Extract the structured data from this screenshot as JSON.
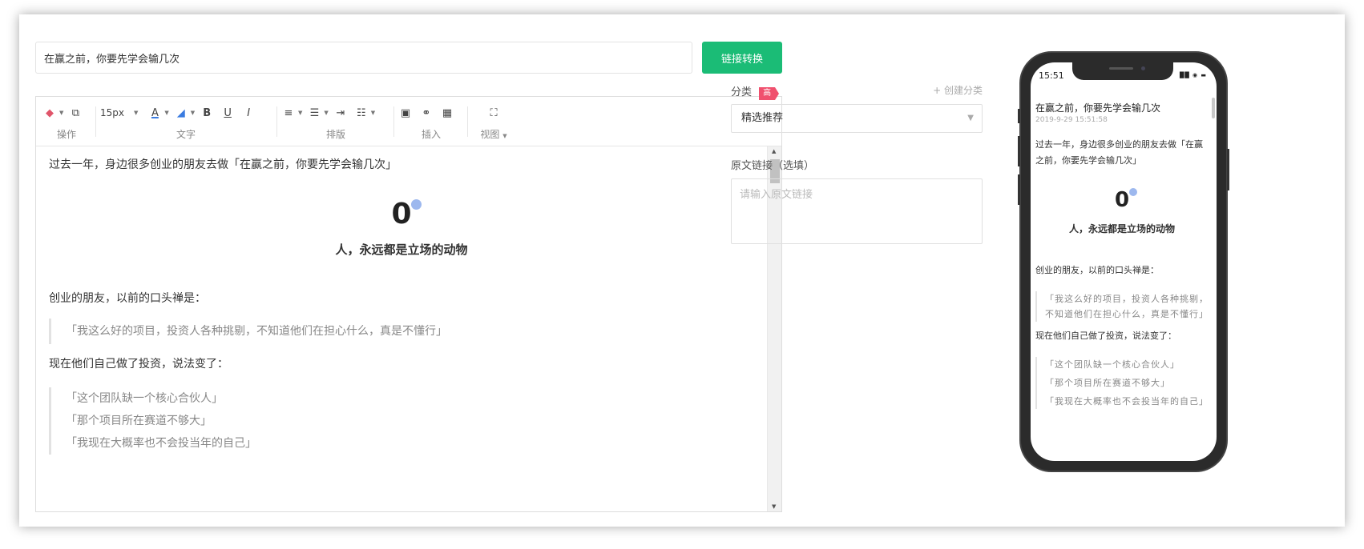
{
  "header": {
    "title_value": "在赢之前，你要先学会输几次",
    "convert_button": "链接转换"
  },
  "toolbar": {
    "font_size": "15px",
    "groups": {
      "operate": "操作",
      "text": "文字",
      "layout": "排版",
      "insert": "插入",
      "view": "视图"
    }
  },
  "content": {
    "intro": "过去一年，身边很多创业的朋友去做「在赢之前，你要先学会输几次」",
    "zero": "0",
    "subhead": "人，永远都是立场的动物",
    "para1": "创业的朋友，以前的口头禅是：",
    "quote1": "「我这么好的项目，投资人各种挑剔，不知道他们在担心什么，真是不懂行」",
    "para2": "现在他们自己做了投资，说法变了：",
    "quote2_lines": [
      "「这个团队缺一个核心合伙人」",
      "「那个项目所在赛道不够大」",
      "「我现在大概率也不会投当年的自己」"
    ]
  },
  "sidebar": {
    "category_label": "分类",
    "badge": "高",
    "create_category": "+ 创建分类",
    "category_selected": "精选推荐",
    "source_label": "原文链接（选填）",
    "source_placeholder": "请输入原文链接"
  },
  "phone": {
    "time": "15:51",
    "title": "在赢之前，你要先学会输几次",
    "date": "2019-9-29 15:51:58",
    "intro": "过去一年，身边很多创业的朋友去做「在赢之前，你要先学会输几次」",
    "zero": "0",
    "subhead": "人，永远都是立场的动物",
    "para1": "创业的朋友，以前的口头禅是：",
    "quote1": "「我这么好的项目，投资人各种挑剔，不知道他们在担心什么，真是不懂行」",
    "para2": "现在他们自己做了投资，说法变了：",
    "quote2_lines": [
      "「这个团队缺一个核心合伙人」",
      "「那个项目所在赛道不够大」",
      "「我现在大概率也不会投当年的自己」"
    ]
  },
  "colors": {
    "accent": "#1bbc76",
    "badge": "#f0506e"
  }
}
